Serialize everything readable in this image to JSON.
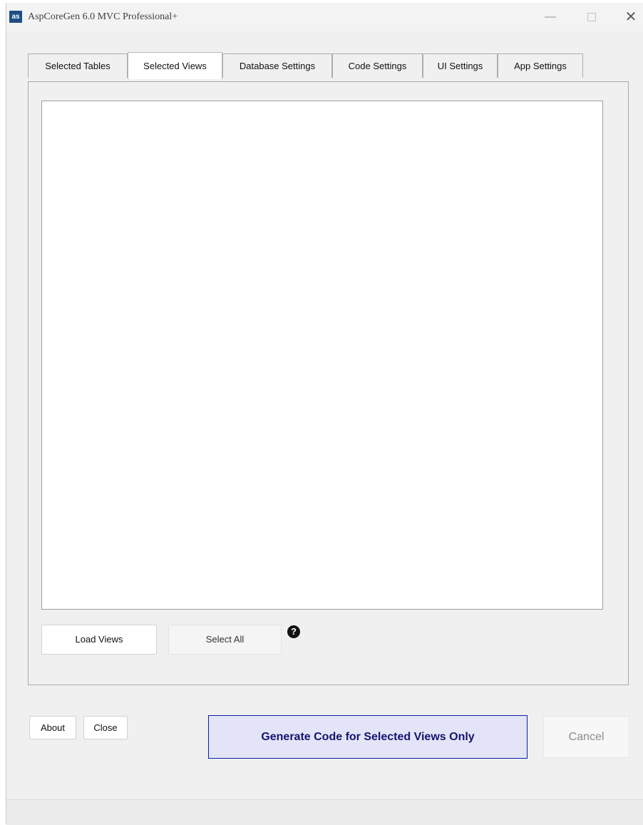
{
  "window": {
    "app_icon_text": "as",
    "title": "AspCoreGen 6.0 MVC Professional+",
    "controls": {
      "minimize": "—",
      "maximize": "□",
      "close": "✕"
    }
  },
  "tabs": [
    {
      "label": "Selected Tables",
      "active": false
    },
    {
      "label": "Selected Views",
      "active": true
    },
    {
      "label": "Database Settings",
      "active": false
    },
    {
      "label": "Code Settings",
      "active": false
    },
    {
      "label": "UI Settings",
      "active": false
    },
    {
      "label": "App Settings",
      "active": false
    }
  ],
  "views_panel": {
    "items": [],
    "load_views_label": "Load Views",
    "select_all_label": "Select All",
    "select_all_enabled": false,
    "help_icon": "question-circle-icon"
  },
  "footer": {
    "about_label": "About",
    "close_label": "Close",
    "generate_label": "Generate Code for Selected Views Only",
    "cancel_label": "Cancel",
    "cancel_enabled": false
  },
  "colors": {
    "generate_bg": "#e4e4f8",
    "generate_border": "#0a1fa0",
    "generate_text": "#14146e",
    "app_icon_bg": "#1d4f86"
  }
}
